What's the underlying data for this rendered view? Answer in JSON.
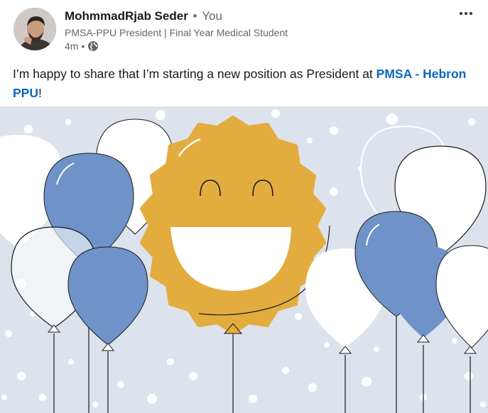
{
  "author": {
    "name": "MohmmadRjab Seder",
    "separator": "•",
    "relation": "You",
    "headline": "PMSA-PPU President | Final Year Medical Student",
    "time": "4m",
    "visibility_icon": "globe-icon"
  },
  "post": {
    "text_before": "I’m happy to share that I’m starting a new position as President at ",
    "mention": "PMSA - Hebron PPU",
    "text_after": "!"
  },
  "menu": {
    "icon": "more-horizontal-icon"
  },
  "colors": {
    "name": "#191919",
    "secondary": "#666666",
    "link": "#0a66c2",
    "illustration_bg": "#dde3ec",
    "balloon_blue": "#6f93c8",
    "smiley_gold": "#e2ad3e"
  }
}
